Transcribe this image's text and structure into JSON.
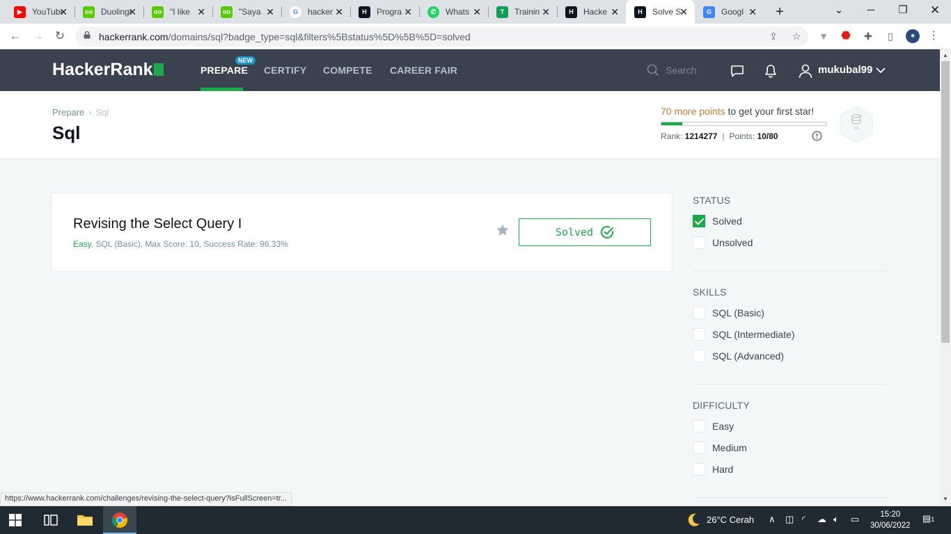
{
  "browser": {
    "tabs": [
      {
        "title": "YouTube",
        "favicon": "youtube-icon",
        "color": "#ff0000"
      },
      {
        "title": "Duolingo",
        "favicon": "duolingo-icon",
        "color": "#58cc02"
      },
      {
        "title": "\"I like",
        "favicon": "duolingo-icon",
        "color": "#58cc02"
      },
      {
        "title": "\"Saya",
        "favicon": "duolingo-icon",
        "color": "#58cc02"
      },
      {
        "title": "hacker",
        "favicon": "google-icon",
        "color": "#4285f4"
      },
      {
        "title": "Progra",
        "favicon": "hackerrank-icon",
        "color": "#0e141e"
      },
      {
        "title": "Whats",
        "favicon": "whatsapp-icon",
        "color": "#25d366"
      },
      {
        "title": "Trainin",
        "favicon": "training-icon",
        "color": "#0f9d58"
      },
      {
        "title": "Hacke",
        "favicon": "hackerrank-icon",
        "color": "#0e141e"
      },
      {
        "title": "Solve S",
        "favicon": "hackerrank-icon",
        "color": "#0e141e",
        "active": true
      },
      {
        "title": "Googl",
        "favicon": "google-translate-icon",
        "color": "#4285f4"
      }
    ],
    "url_host": "hackerrank.com",
    "url_rest": "/domains/sql?badge_type=sql&filters%5Bstatus%5D%5B%5D=solved",
    "status_url": "https://www.hackerrank.com/challenges/revising-the-select-query?isFullScreen=tr..."
  },
  "nav": {
    "logo": "HackerRank",
    "links": [
      "PREPARE",
      "CERTIFY",
      "COMPETE",
      "CAREER FAIR"
    ],
    "new_badge": "NEW",
    "search_placeholder": "Search",
    "username": "mukubal99"
  },
  "header": {
    "breadcrumb": [
      "Prepare",
      "Sql"
    ],
    "title": "Sql",
    "points_needed": "70 more points",
    "star_message": " to get your first star!",
    "progress_fraction": 0.125,
    "rank_label": "Rank:",
    "rank": "1214277",
    "points_label": "Points:",
    "points": "10/80",
    "badge_label": "Sql"
  },
  "challenge": {
    "title": "Revising the Select Query I",
    "difficulty": "Easy",
    "meta_rest": ", SQL (Basic), Max Score: 10, Success Rate: 96.33%",
    "status_button": "Solved"
  },
  "filters": {
    "status": {
      "title": "STATUS",
      "options": [
        {
          "label": "Solved",
          "checked": true
        },
        {
          "label": "Unsolved",
          "checked": false
        }
      ]
    },
    "skills": {
      "title": "SKILLS",
      "options": [
        {
          "label": "SQL (Basic)",
          "checked": false
        },
        {
          "label": "SQL (Intermediate)",
          "checked": false
        },
        {
          "label": "SQL (Advanced)",
          "checked": false
        }
      ]
    },
    "difficulty": {
      "title": "DIFFICULTY",
      "options": [
        {
          "label": "Easy",
          "checked": false
        },
        {
          "label": "Medium",
          "checked": false
        },
        {
          "label": "Hard",
          "checked": false
        }
      ]
    }
  },
  "taskbar": {
    "weather": "26°C  Cerah",
    "time": "15:20",
    "date": "30/06/2022",
    "notifications": "1"
  },
  "colors": {
    "brand_green": "#1ba94c",
    "nav_bg": "#39424e",
    "points_orange": "#c27a35"
  }
}
